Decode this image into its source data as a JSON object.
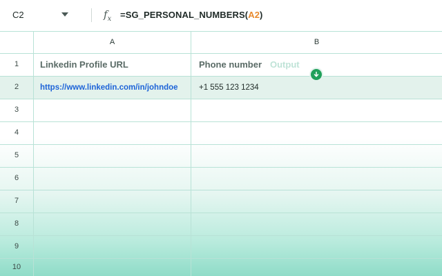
{
  "formula_bar": {
    "cell_ref": "C2",
    "fx_label": "f",
    "fx_sub": "x",
    "formula_prefix": "=SG_PERSONAL_NUMBERS(",
    "formula_ref": "A2",
    "formula_suffix": ")"
  },
  "columns": [
    "A",
    "B"
  ],
  "rows": [
    "1",
    "2",
    "3",
    "4",
    "5",
    "6",
    "7",
    "8",
    "9",
    "10"
  ],
  "cells": {
    "a1": "Linkedin Profile URL",
    "b1": "Phone number",
    "b1_hint": "Output",
    "a2": "https://www.linkedin.com/in/johndoe",
    "b2": "+1 555 123 1234"
  },
  "colors": {
    "accent": "#20a05a",
    "link": "#1d63d8",
    "formula_ref": "#e8892c"
  },
  "icons": {
    "download": "download-icon",
    "dropdown": "chevron-down-icon",
    "function": "function-icon"
  }
}
